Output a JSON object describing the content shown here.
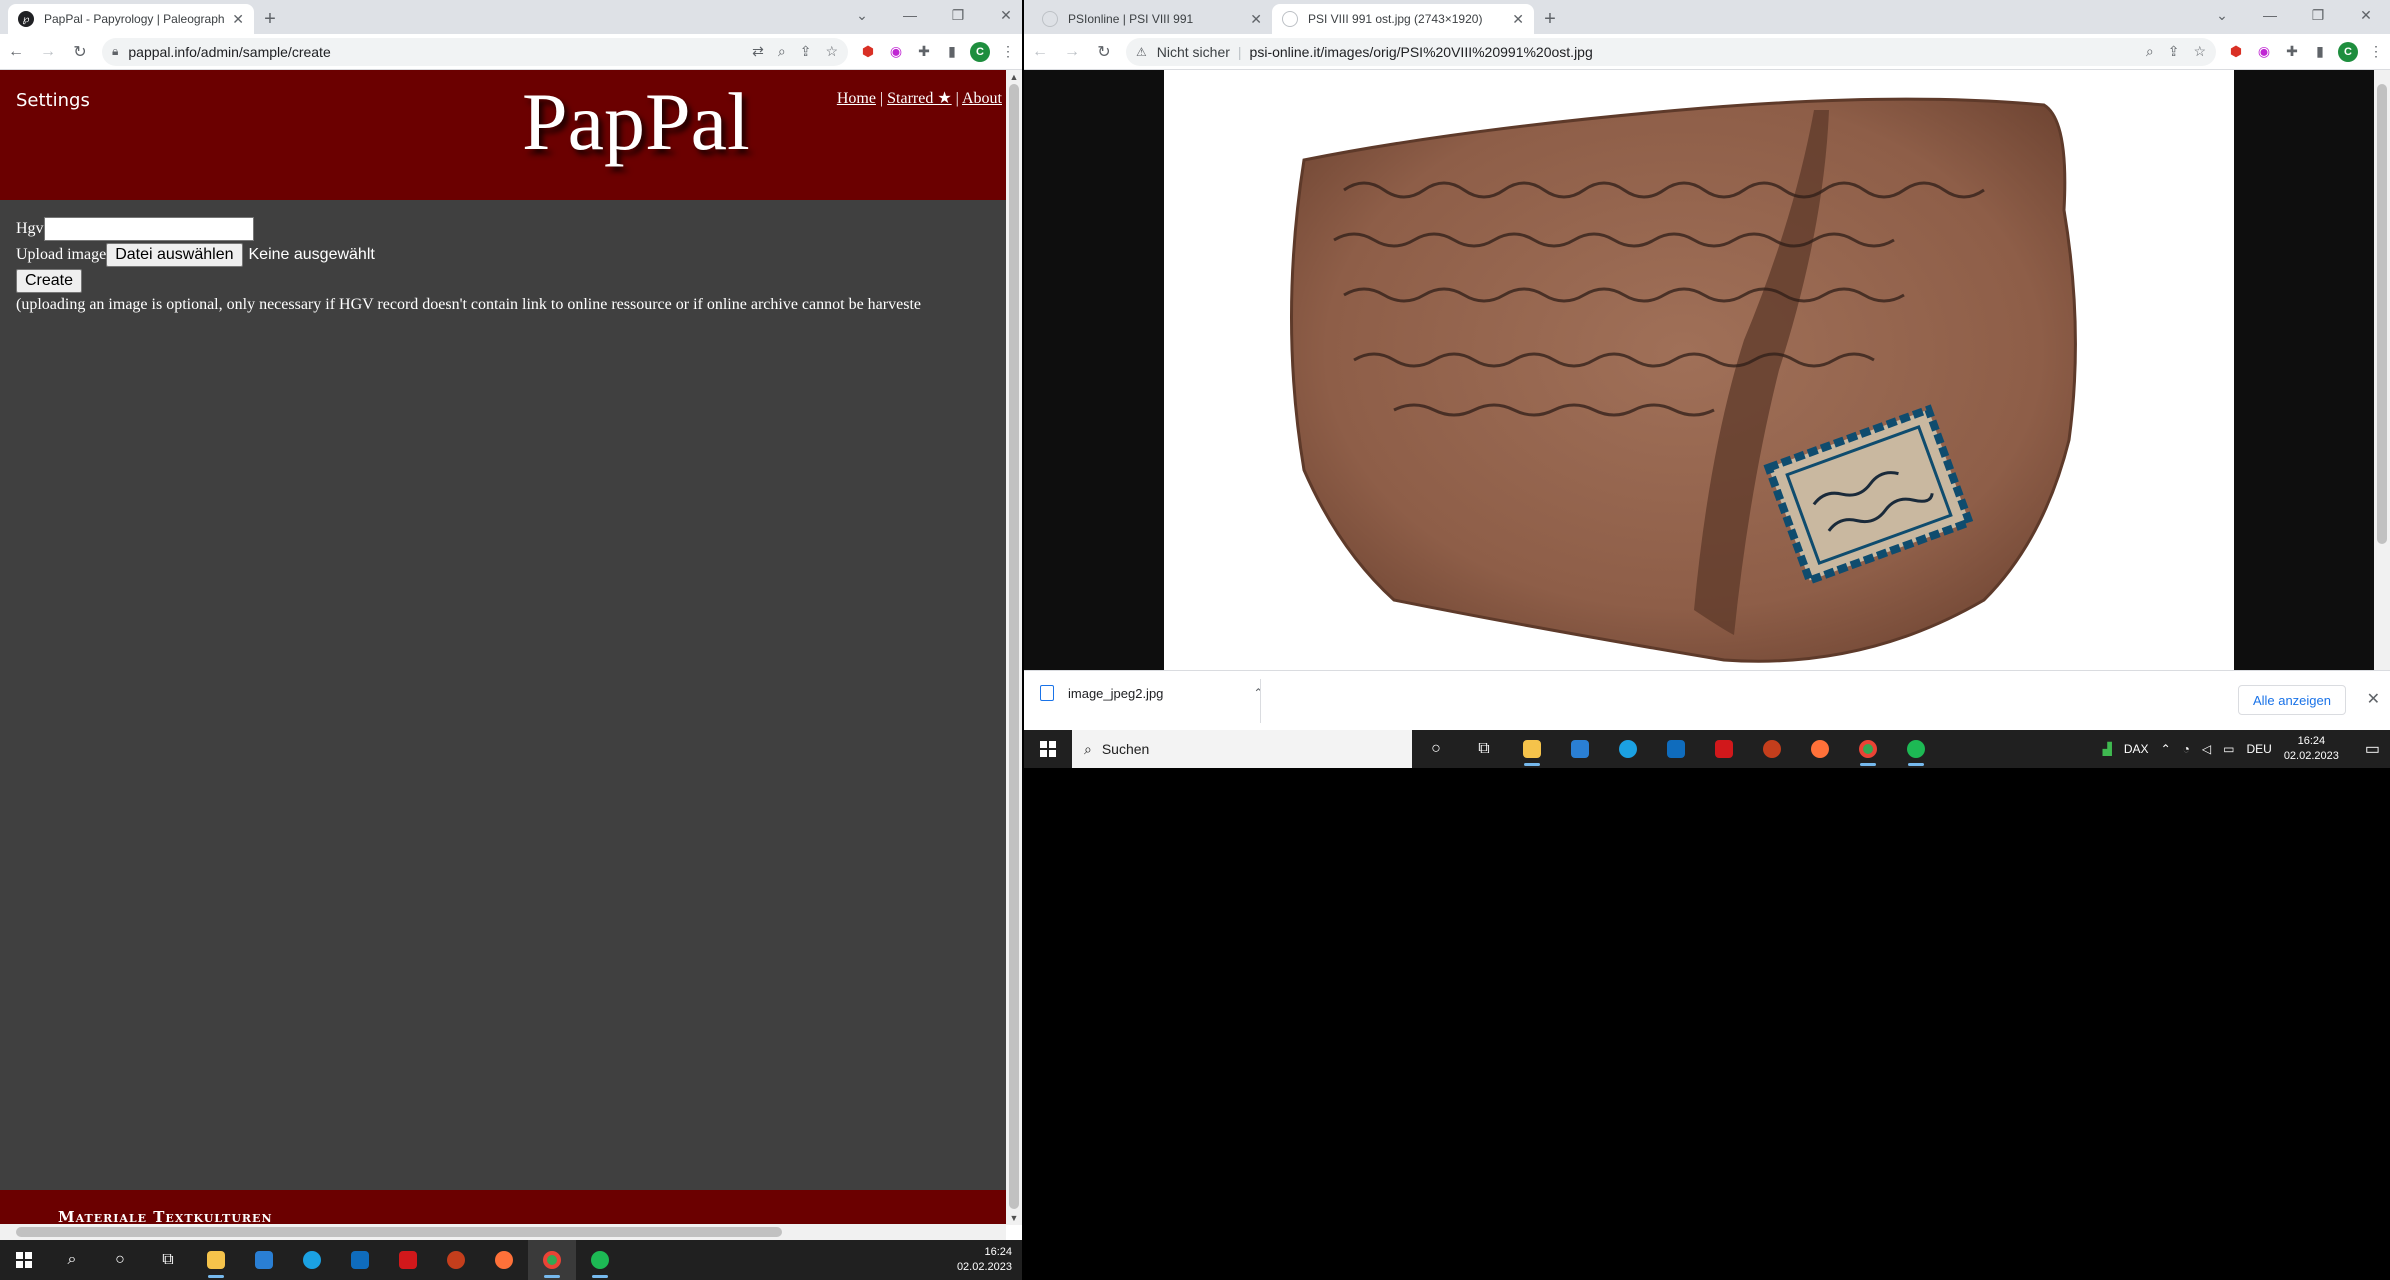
{
  "left_browser": {
    "tabs": [
      {
        "title": "PapPal - Papyrology | Paleograph",
        "active": true
      }
    ],
    "address": "pappal.info/admin/sample/create",
    "new_tab": "+",
    "window_controls": [
      "⌄",
      "—",
      "❐",
      "✕"
    ]
  },
  "pappal": {
    "settings": "Settings",
    "logo": "PapPal",
    "nav": {
      "home": "Home",
      "starred": "Starred ★",
      "about": "About",
      "sep": "|"
    },
    "form": {
      "hgv_label": "Hgv",
      "hgv_value": "",
      "upload_label": "Upload image",
      "file_button": "Datei auswählen",
      "file_status": "Keine ausgewählt",
      "create_button": "Create",
      "note": "(uploading an image is optional, only necessary if HGV record doesn't contain link to online ressource or if online archive cannot be harveste"
    },
    "footer": "Materiale Textkulturen",
    "colors": {
      "header": "#6b0000",
      "body": "#404040"
    }
  },
  "right_browser": {
    "tabs": [
      {
        "title": "PSIonline | PSI VIII 991",
        "active": false
      },
      {
        "title": "PSI VIII 991 ost.jpg (2743×1920)",
        "active": true
      }
    ],
    "security": "Nicht sicher",
    "address": "psi-online.it/images/orig/PSI%20VIII%20991%20ost.jpg",
    "new_tab": "+",
    "window_controls": [
      "⌄",
      "—",
      "❐",
      "✕"
    ]
  },
  "downloads": {
    "file": "image_jpeg2.jpg",
    "show_all": "Alle anzeigen"
  },
  "taskbar_right": {
    "search": "Suchen",
    "dax": "DAX",
    "lang": "DEU",
    "time": "16:24",
    "date": "02.02.2023"
  },
  "taskbar_left": {
    "time": "16:24",
    "date": "02.02.2023"
  },
  "icons": [
    "back-icon",
    "forward-icon",
    "reload-icon",
    "lock-icon",
    "translate-icon",
    "zoom-icon",
    "share-icon",
    "star-icon",
    "extensions-icon",
    "sidebar-icon",
    "menu-icon",
    "windows-icon",
    "search-icon",
    "cortana-icon",
    "task-view-icon",
    "explorer-icon",
    "store-icon",
    "edge-icon",
    "mail-icon",
    "acrobat-icon",
    "powerpoint-icon",
    "firefox-icon",
    "chrome-icon",
    "spotify-icon"
  ]
}
